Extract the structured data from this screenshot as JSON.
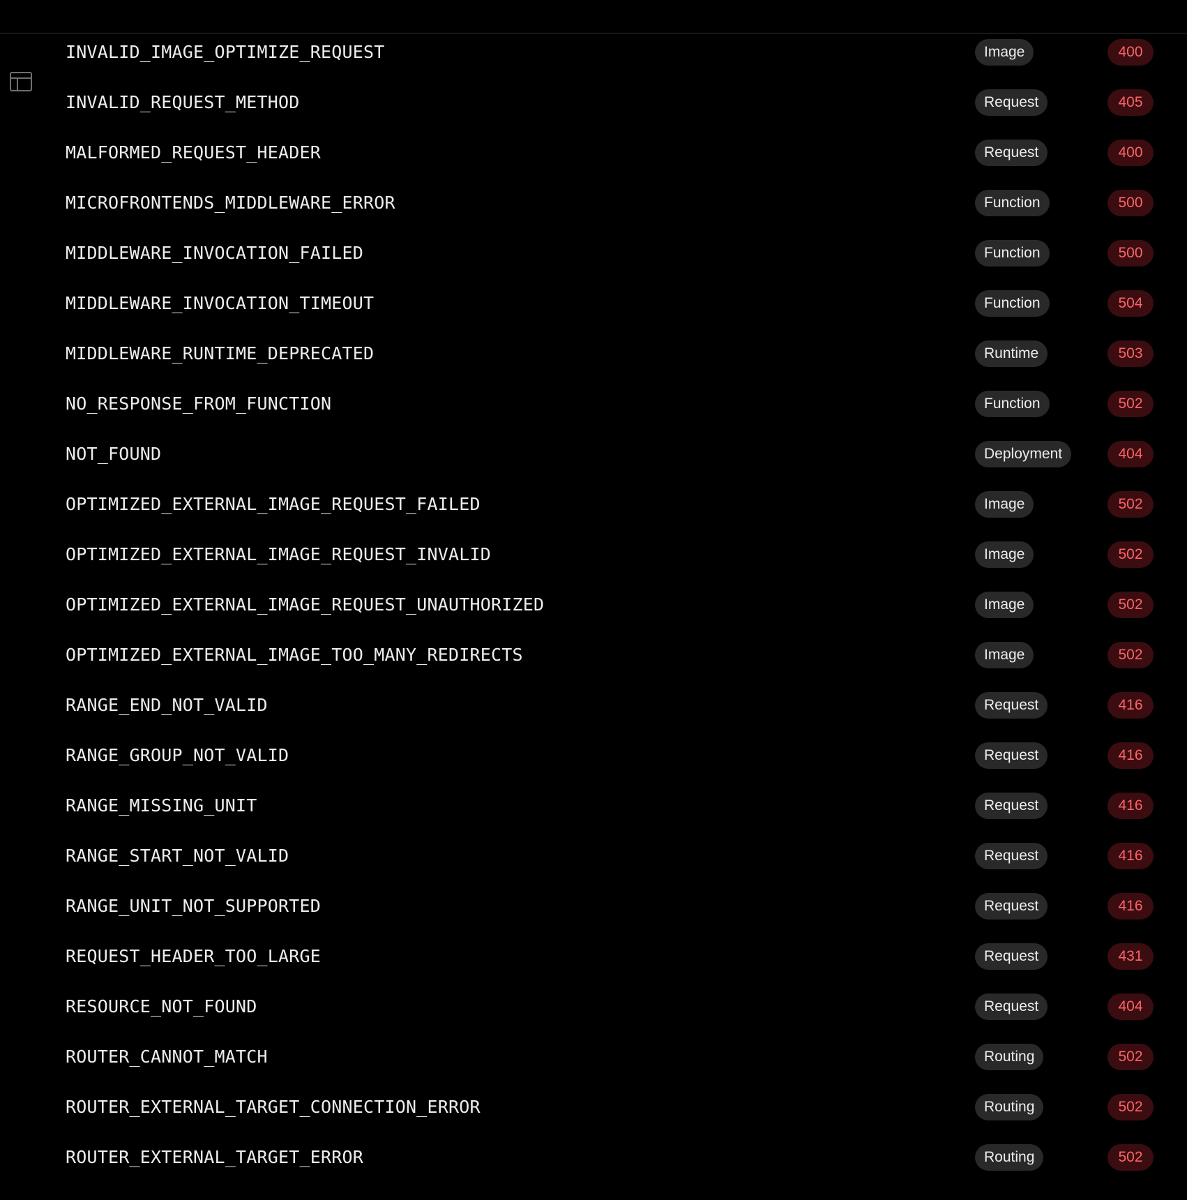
{
  "sidebar_toggle": {
    "icon": "layout-sidebar-icon"
  },
  "colors": {
    "background": "#000000",
    "text": "#ededed",
    "category_badge_bg": "#292929",
    "status_badge_bg": "#3b0d10",
    "status_badge_text": "#ff6369"
  },
  "errors": [
    {
      "code": "INVALID_IMAGE_OPTIMIZE_REQUEST",
      "category": "Image",
      "status": "400"
    },
    {
      "code": "INVALID_REQUEST_METHOD",
      "category": "Request",
      "status": "405"
    },
    {
      "code": "MALFORMED_REQUEST_HEADER",
      "category": "Request",
      "status": "400"
    },
    {
      "code": "MICROFRONTENDS_MIDDLEWARE_ERROR",
      "category": "Function",
      "status": "500"
    },
    {
      "code": "MIDDLEWARE_INVOCATION_FAILED",
      "category": "Function",
      "status": "500"
    },
    {
      "code": "MIDDLEWARE_INVOCATION_TIMEOUT",
      "category": "Function",
      "status": "504"
    },
    {
      "code": "MIDDLEWARE_RUNTIME_DEPRECATED",
      "category": "Runtime",
      "status": "503"
    },
    {
      "code": "NO_RESPONSE_FROM_FUNCTION",
      "category": "Function",
      "status": "502"
    },
    {
      "code": "NOT_FOUND",
      "category": "Deployment",
      "status": "404"
    },
    {
      "code": "OPTIMIZED_EXTERNAL_IMAGE_REQUEST_FAILED",
      "category": "Image",
      "status": "502"
    },
    {
      "code": "OPTIMIZED_EXTERNAL_IMAGE_REQUEST_INVALID",
      "category": "Image",
      "status": "502"
    },
    {
      "code": "OPTIMIZED_EXTERNAL_IMAGE_REQUEST_UNAUTHORIZED",
      "category": "Image",
      "status": "502"
    },
    {
      "code": "OPTIMIZED_EXTERNAL_IMAGE_TOO_MANY_REDIRECTS",
      "category": "Image",
      "status": "502"
    },
    {
      "code": "RANGE_END_NOT_VALID",
      "category": "Request",
      "status": "416"
    },
    {
      "code": "RANGE_GROUP_NOT_VALID",
      "category": "Request",
      "status": "416"
    },
    {
      "code": "RANGE_MISSING_UNIT",
      "category": "Request",
      "status": "416"
    },
    {
      "code": "RANGE_START_NOT_VALID",
      "category": "Request",
      "status": "416"
    },
    {
      "code": "RANGE_UNIT_NOT_SUPPORTED",
      "category": "Request",
      "status": "416"
    },
    {
      "code": "REQUEST_HEADER_TOO_LARGE",
      "category": "Request",
      "status": "431"
    },
    {
      "code": "RESOURCE_NOT_FOUND",
      "category": "Request",
      "status": "404"
    },
    {
      "code": "ROUTER_CANNOT_MATCH",
      "category": "Routing",
      "status": "502"
    },
    {
      "code": "ROUTER_EXTERNAL_TARGET_CONNECTION_ERROR",
      "category": "Routing",
      "status": "502"
    },
    {
      "code": "ROUTER_EXTERNAL_TARGET_ERROR",
      "category": "Routing",
      "status": "502"
    }
  ]
}
